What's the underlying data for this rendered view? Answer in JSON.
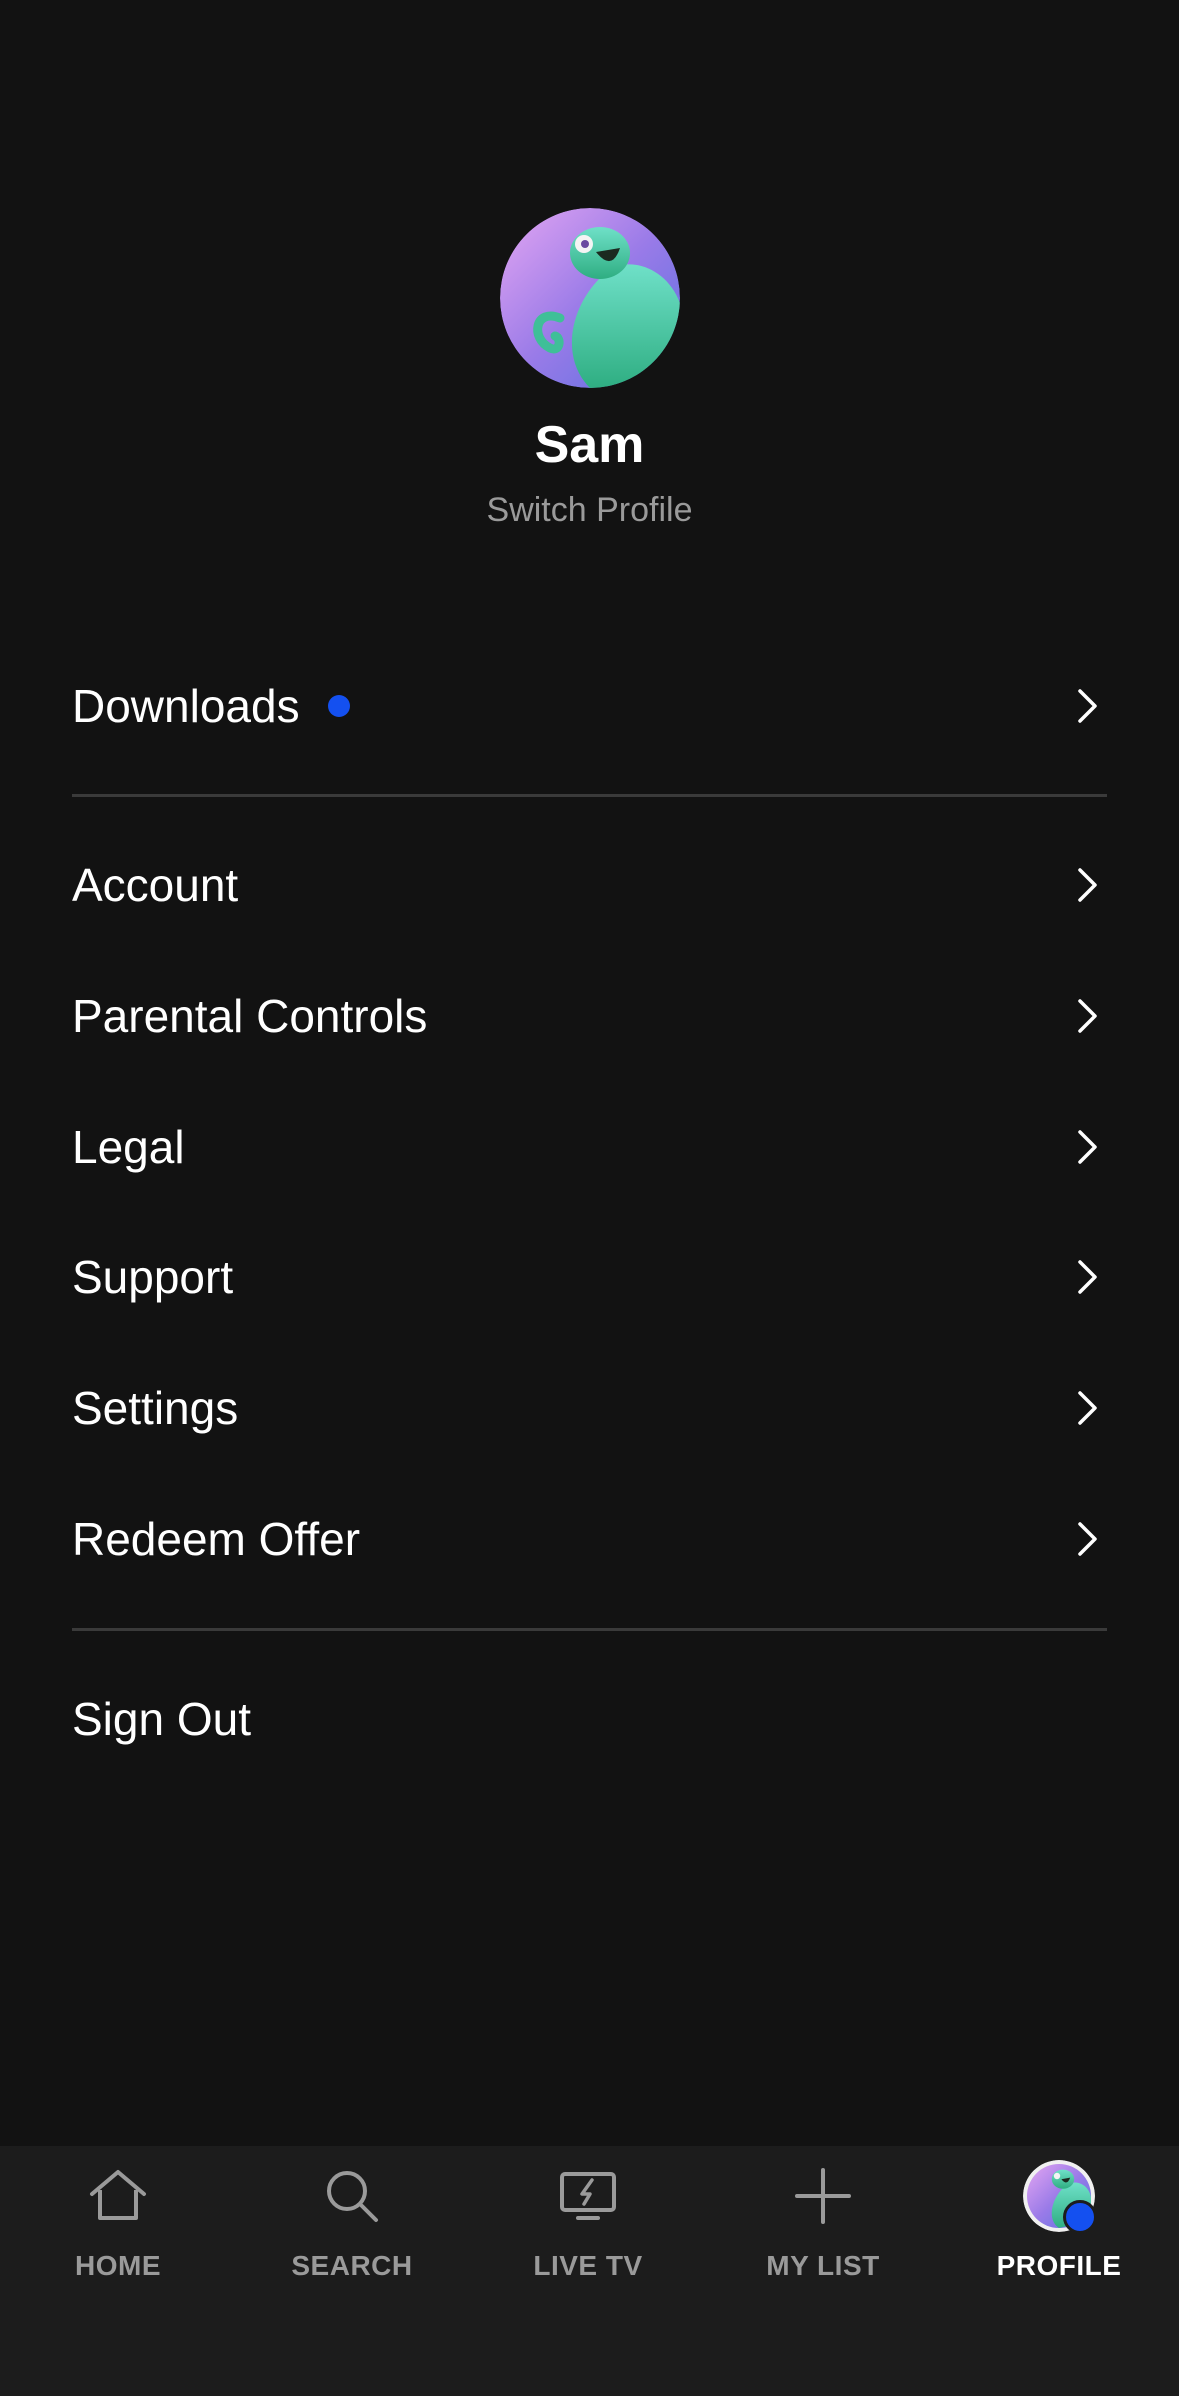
{
  "colors": {
    "background": "#121212",
    "tabbar_background": "#1c1c1c",
    "accent_dot": "#1450f0",
    "muted_text": "#9a9a9a",
    "divider": "#3a3a3a"
  },
  "profile": {
    "name": "Sam",
    "switch_label": "Switch Profile",
    "avatar_icon": "green-creature-avatar-icon"
  },
  "menu": {
    "downloads": {
      "label": "Downloads",
      "has_badge": true
    },
    "account": {
      "label": "Account"
    },
    "parental_controls": {
      "label": "Parental Controls"
    },
    "legal": {
      "label": "Legal"
    },
    "support": {
      "label": "Support"
    },
    "settings": {
      "label": "Settings"
    },
    "redeem_offer": {
      "label": "Redeem Offer"
    },
    "sign_out": {
      "label": "Sign Out"
    }
  },
  "tabbar": {
    "home": {
      "label": "HOME",
      "icon": "home-icon"
    },
    "search": {
      "label": "SEARCH",
      "icon": "search-icon"
    },
    "live_tv": {
      "label": "LIVE TV",
      "icon": "live-tv-icon"
    },
    "my_list": {
      "label": "MY LIST",
      "icon": "plus-icon"
    },
    "profile": {
      "label": "PROFILE",
      "icon": "profile-avatar-icon",
      "active": true
    }
  }
}
